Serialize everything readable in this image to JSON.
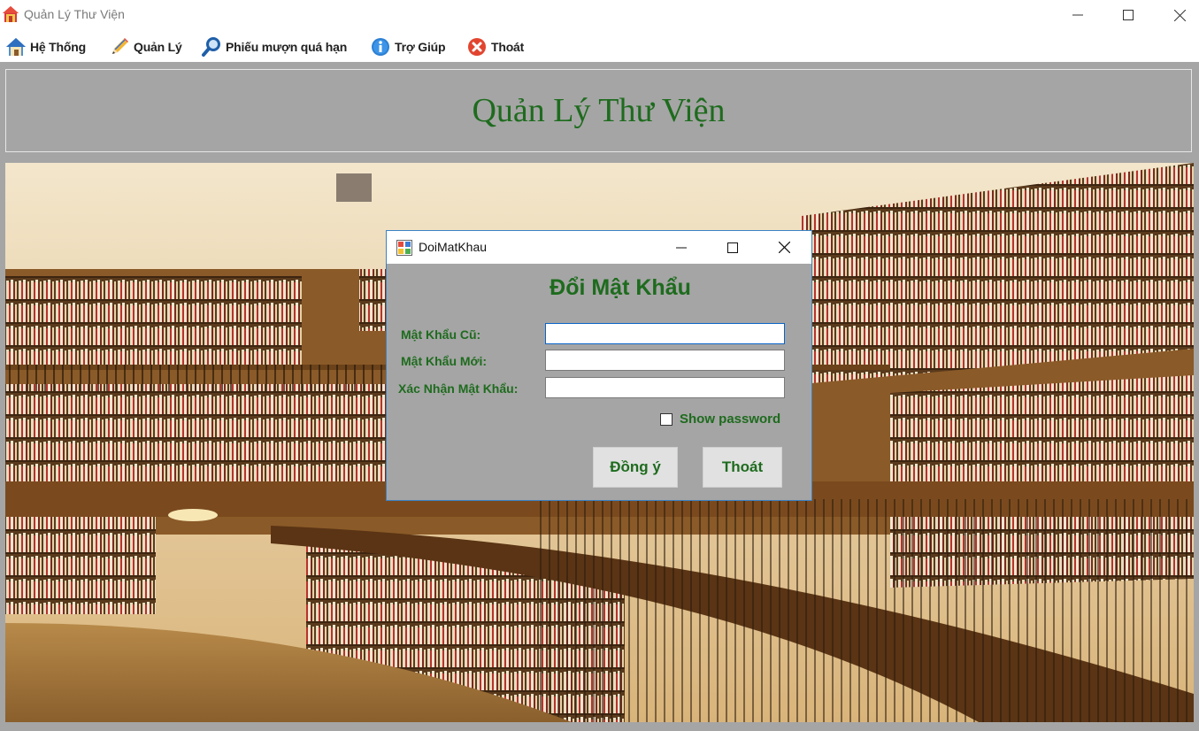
{
  "window": {
    "title": "Quản Lý Thư Viện",
    "icon": "house-icon",
    "controls": [
      "minimize-icon",
      "maximize-icon",
      "close-icon"
    ]
  },
  "menu": {
    "items": [
      {
        "label": "Hệ Thống",
        "icon": "home-icon"
      },
      {
        "label": "Quản Lý",
        "icon": "pencil-icon"
      },
      {
        "label": "Phiếu mượn quá hạn",
        "icon": "magnifier-icon"
      },
      {
        "label": "Trợ Giúp",
        "icon": "info-icon"
      },
      {
        "label": "Thoát",
        "icon": "close-circle-icon"
      }
    ]
  },
  "header": {
    "title": "Quản Lý Thư Viện",
    "color": "#1e6b1e"
  },
  "dialog": {
    "title": "DoiMatKhau",
    "heading": "Đổi Mật Khẩu",
    "fields": [
      {
        "label": "Mật Khẩu Cũ:",
        "value": ""
      },
      {
        "label": "Mật Khẩu Mới:",
        "value": ""
      },
      {
        "label": "Xác Nhận Mật Khẩu:",
        "value": ""
      }
    ],
    "show_password": {
      "label": "Show password",
      "checked": false
    },
    "buttons": {
      "ok": "Đồng ý",
      "exit": "Thoát"
    }
  },
  "colors": {
    "accent_green": "#1e6b1e",
    "panel_gray": "#a5a5a5",
    "focus_blue": "#0a64c8"
  }
}
